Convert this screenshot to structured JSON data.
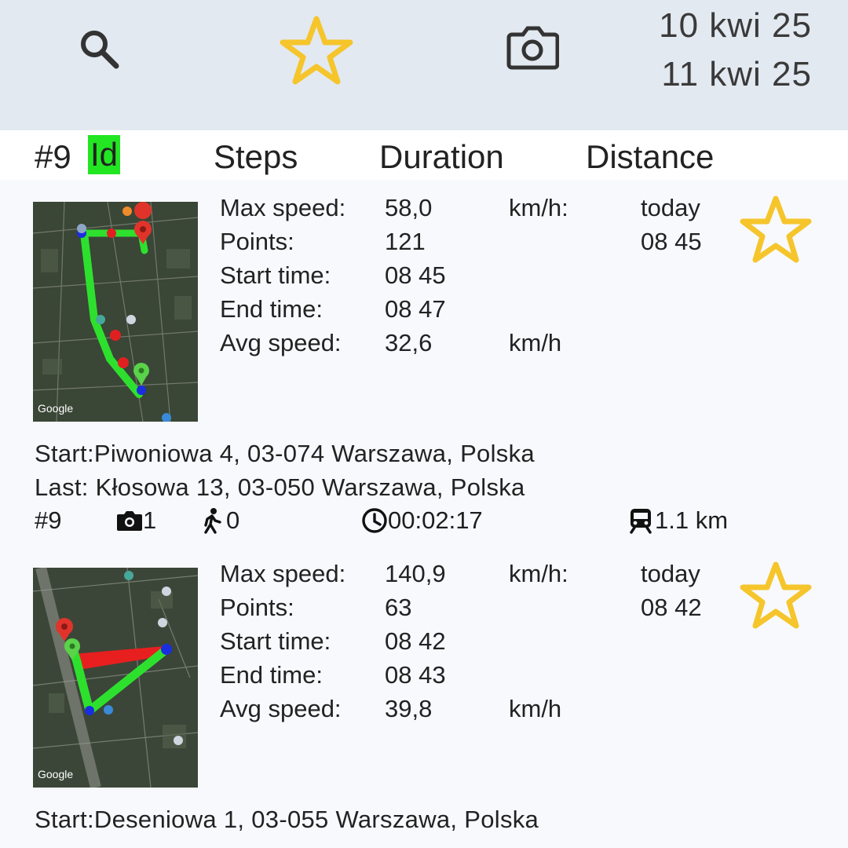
{
  "toolbar": {
    "search_icon": "search-icon",
    "star_icon": "star-outline-icon",
    "camera_icon": "camera-icon",
    "date_from": "10 kwi 25",
    "date_to": "11 kwi 25",
    "star_color": "#f5c52b"
  },
  "columns": {
    "count": "#9",
    "id": "Id",
    "steps": "Steps",
    "duration": "Duration",
    "distance": "Distance",
    "id_highlight": "#22e622"
  },
  "trips": [
    {
      "map_label": "Google",
      "labels": {
        "max_speed": "Max speed:",
        "points": "Points:",
        "start_time": "Start time:",
        "end_time": "End time:",
        "avg_speed": "Avg speed:"
      },
      "max_speed": "58,0",
      "max_speed_unit": "km/h:",
      "points": "121",
      "start_time": "08 45",
      "end_time": "08 47",
      "avg_speed": "32,6",
      "avg_speed_unit": "km/h",
      "day": "today",
      "time": "08 45",
      "start_label": "Start:",
      "start_address": "Piwoniowa 4, 03-074 Warszawa, Polska",
      "last_label": "Last:",
      "last_address": "Kłosowa 13, 03-050 Warszawa, Polska",
      "id": "#9",
      "photos": "1",
      "steps": "0",
      "duration": "00:02:17",
      "distance": "1.1 km"
    },
    {
      "map_label": "Google",
      "labels": {
        "max_speed": "Max speed:",
        "points": "Points:",
        "start_time": "Start time:",
        "end_time": "End time:",
        "avg_speed": "Avg speed:"
      },
      "max_speed": "140,9",
      "max_speed_unit": "km/h:",
      "points": "63",
      "start_time": "08 42",
      "end_time": "08 43",
      "avg_speed": "39,8",
      "avg_speed_unit": "km/h",
      "day": "today",
      "time": "08 42",
      "start_label": "Start:",
      "start_address": "Deseniowa 1, 03-055 Warszawa, Polska"
    }
  ]
}
